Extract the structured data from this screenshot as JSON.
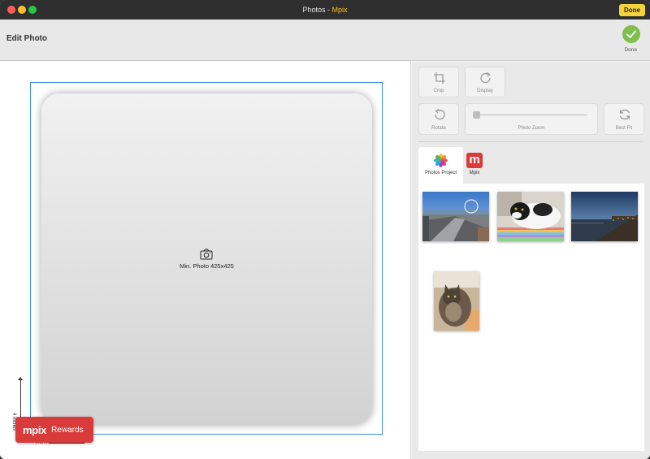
{
  "window": {
    "title_app": "Photos",
    "title_sep": " - ",
    "title_accent": "Mpix",
    "done_top": "Done"
  },
  "header": {
    "title": "Edit Photo",
    "done_label": "Done",
    "done_color": "#7fbf4d"
  },
  "canvas": {
    "min_photo_text": "Min. Photo 425x425",
    "dim_vertical": "4 inches",
    "dim_horizontal": "4 inches",
    "frame_color": "#3b8fe0"
  },
  "rewards": {
    "brand": "mpix",
    "label": "Rewards",
    "color": "#d93a3a"
  },
  "tools": {
    "crop": "Crop",
    "display": "Display",
    "rotate": "Rotate",
    "photo_zoom": "Photo Zoom",
    "best_fit": "Best Fit",
    "zoom_level": 0
  },
  "source_tabs": [
    {
      "label": "Photos Project",
      "icon": "photos-app-icon",
      "selected": true
    },
    {
      "label": "Mpix",
      "icon": "mpix-logo-icon",
      "selected": false
    }
  ],
  "gallery": {
    "photos": [
      {
        "name": "photo-city-skyline"
      },
      {
        "name": "photo-cat-on-rug"
      },
      {
        "name": "photo-harbor-dusk"
      },
      {
        "name": "photo-fluffy-cat"
      }
    ]
  }
}
